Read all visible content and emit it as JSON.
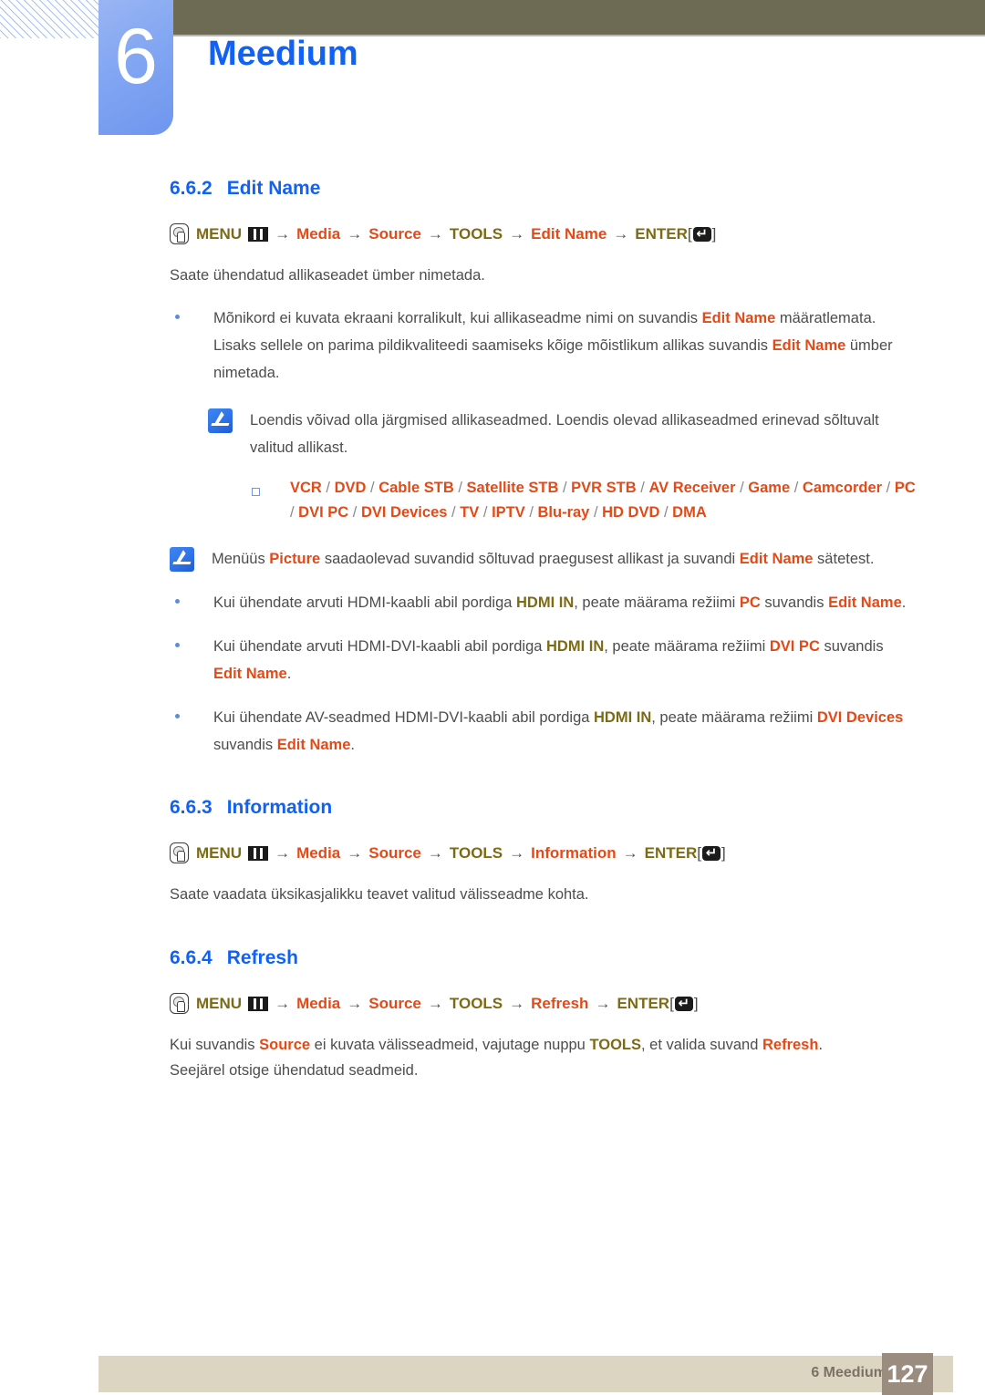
{
  "header": {
    "chapter_number": "6",
    "chapter_title": "Meedium"
  },
  "sections": [
    {
      "number": "6.6.2",
      "title": "Edit Name",
      "path": {
        "menu": "MENU",
        "steps": [
          "Media",
          "Source",
          "TOOLS",
          "Edit Name"
        ],
        "enter": "ENTER",
        "arrow": "→",
        "bracket_open": "[",
        "bracket_close": "]"
      },
      "intro": "Saate ühendatud allikaseadet ümber nimetada."
    },
    {
      "number": "6.6.3",
      "title": "Information",
      "path": {
        "menu": "MENU",
        "steps": [
          "Media",
          "Source",
          "TOOLS",
          "Information"
        ],
        "enter": "ENTER",
        "arrow": "→",
        "bracket_open": "[",
        "bracket_close": "]"
      },
      "intro": "Saate vaadata üksikasjalikku teavet valitud välisseadme kohta."
    },
    {
      "number": "6.6.4",
      "title": "Refresh",
      "path": {
        "menu": "MENU",
        "steps": [
          "Media",
          "Source",
          "TOOLS",
          "Refresh"
        ],
        "enter": "ENTER",
        "arrow": "→",
        "bracket_open": "[",
        "bracket_close": "]"
      },
      "intro_part1": "Kui suvandis ",
      "intro_kw1": "Source",
      "intro_part2": " ei kuvata välisseadmeid, vajutage nuppu ",
      "intro_kw2": "TOOLS",
      "intro_part3": ", et valida suvand ",
      "intro_kw3": "Refresh",
      "intro_part4": ".",
      "intro_line2": "Seejärel otsige ühendatud seadmeid."
    }
  ],
  "bullet_edit_name": {
    "part1": "Mõnikord ei kuvata ekraani korralikult, kui allikaseadme nimi on suvandis ",
    "kw1": "Edit Name",
    "part2": " määratlemata. Lisaks sellele on parima pildikvaliteedi saamiseks kõige mõistlikum allikas suvandis ",
    "kw2": "Edit Name",
    "part3": " ümber nimetada."
  },
  "note_sources": {
    "text": "Loendis võivad olla järgmised allikaseadmed. Loendis olevad allikaseadmed erinevad sõltuvalt valitud allikast.",
    "devices": [
      "VCR",
      "DVD",
      "Cable STB",
      "Satellite STB",
      "PVR STB",
      "AV Receiver",
      "Game",
      "Camcorder",
      "PC",
      "DVI PC",
      "DVI Devices",
      "TV",
      "IPTV",
      "Blu-ray",
      "HD DVD",
      "DMA"
    ],
    "separator": " / "
  },
  "note_picture": {
    "part1": "Menüüs ",
    "kw1": "Picture",
    "part2": " saadaolevad suvandid sõltuvad praegusest allikast ja suvandi ",
    "kw2": "Edit Name",
    "part3": " sätetest."
  },
  "hdmi_bullets": [
    {
      "part1": "Kui ühendate arvuti HDMI-kaabli abil pordiga ",
      "kw1": "HDMI IN",
      "part2": ", peate määrama režiimi ",
      "kw2": "PC",
      "part3": " suvandis ",
      "kw3": "Edit Name",
      "part4": "."
    },
    {
      "part1": "Kui ühendate arvuti HDMI-DVI-kaabli abil pordiga ",
      "kw1": "HDMI IN",
      "part2": ", peate määrama režiimi ",
      "kw2": "DVI PC",
      "part3": " suvandis ",
      "kw3": "Edit Name",
      "part4": "."
    },
    {
      "part1": "Kui ühendate AV-seadmed HDMI-DVI-kaabli abil pordiga ",
      "kw1": "HDMI IN",
      "part2": ", peate määrama režiimi ",
      "kw2": "DVI Devices",
      "part3": " suvandis ",
      "kw3": "Edit Name",
      "part4": "."
    }
  ],
  "footer": {
    "label": "6 Meedium",
    "page": "127"
  },
  "colors": {
    "heading_blue": "#1161f5",
    "keyword_orange": "#e34a17",
    "keyword_olive": "#7d6a14",
    "topbar_brown": "#6e6b55",
    "footer_beige": "#dcd5c2",
    "footer_page_box": "#9b8c80"
  }
}
